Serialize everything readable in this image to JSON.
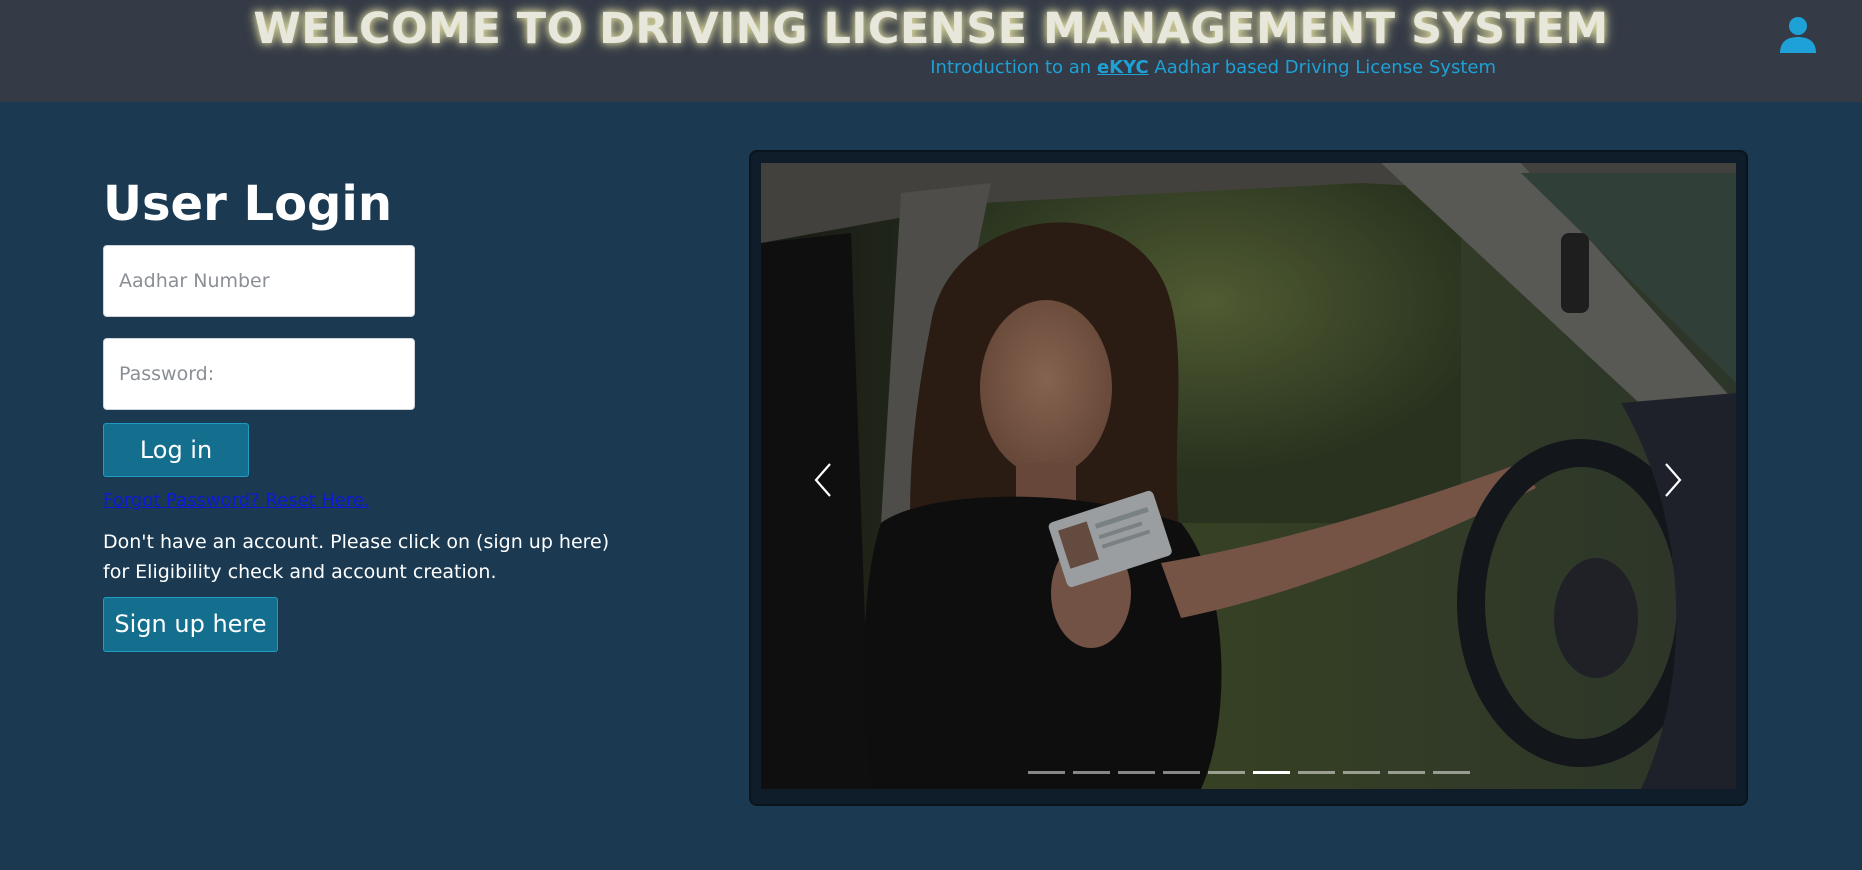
{
  "header": {
    "title": "WELCOME TO DRIVING LICENSE MANAGEMENT SYSTEM",
    "subtitle_prefix": "Introduction to an ",
    "subtitle_link": "eKYC",
    "subtitle_suffix": " Aadhar based Driving License System",
    "user_icon": "user-icon"
  },
  "login": {
    "title": "User Login",
    "aadhar_placeholder": "Aadhar Number",
    "aadhar_value": "",
    "password_placeholder": "Password:",
    "password_value": "",
    "login_button": "Log in",
    "forgot_link": "Forgot Password? Reset Here.",
    "signup_text": "Don't have an account. Please click on (sign up here) for Eligibility check and account creation.",
    "signup_button": "Sign up here"
  },
  "carousel": {
    "image": "Woman smiling in driver's seat holding up a driving license card",
    "prev_icon": "chevron-left-icon",
    "next_icon": "chevron-right-icon",
    "slide_count": 10,
    "active_slide": 6
  },
  "colors": {
    "page_background": "#1b3a52",
    "header_background": "#343a46",
    "accent": "#1ea1d6",
    "button": "#146e8e",
    "link": "#0d1bd6"
  }
}
